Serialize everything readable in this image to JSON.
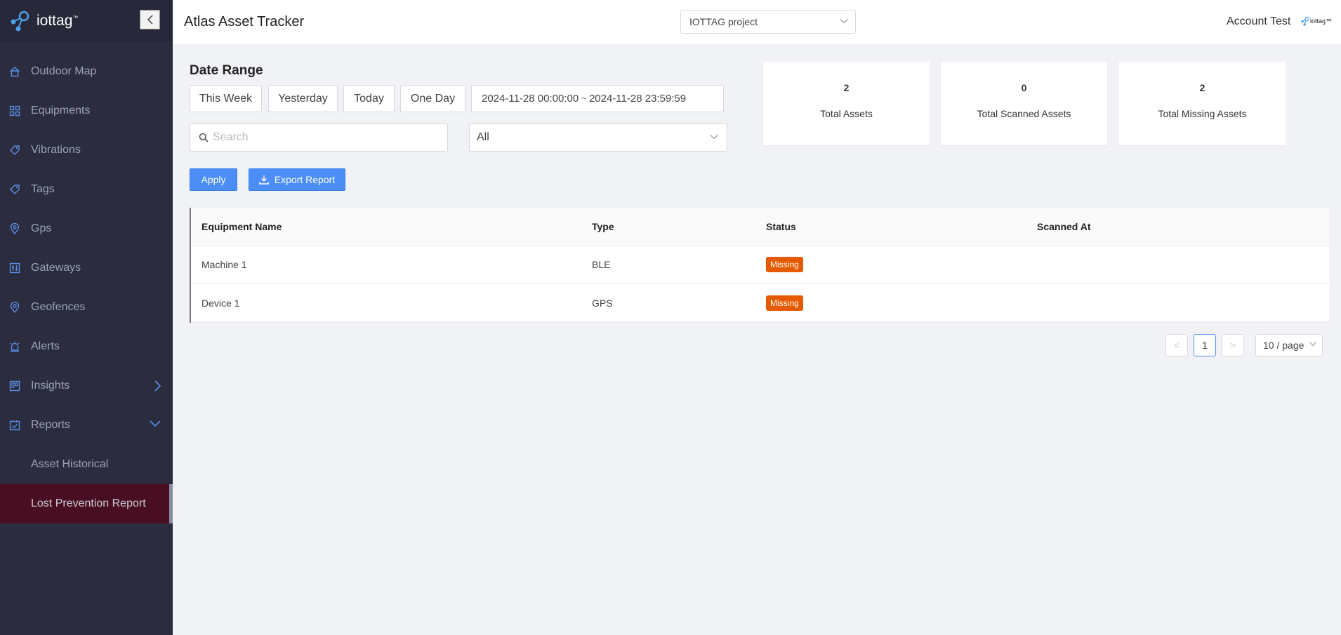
{
  "brand": {
    "name": "iottag",
    "tm": "™"
  },
  "header": {
    "title": "Atlas Asset Tracker",
    "project": "IOTTAG project",
    "account": "Account Test",
    "mini_logo": "iottag™"
  },
  "sidebar": {
    "items": [
      {
        "label": "Outdoor Map",
        "icon": "home-icon"
      },
      {
        "label": "Equipments",
        "icon": "grid-icon"
      },
      {
        "label": "Vibrations",
        "icon": "tag-icon"
      },
      {
        "label": "Tags",
        "icon": "tag-icon"
      },
      {
        "label": "Gps",
        "icon": "location-pin-icon"
      },
      {
        "label": "Gateways",
        "icon": "sliders-icon"
      },
      {
        "label": "Geofences",
        "icon": "location-pin-icon"
      },
      {
        "label": "Alerts",
        "icon": "alarm-icon"
      },
      {
        "label": "Insights",
        "icon": "board-icon"
      },
      {
        "label": "Reports",
        "icon": "checklist-icon"
      }
    ],
    "sub_items": [
      {
        "label": "Asset Historical"
      },
      {
        "label": "Lost Prevention Report"
      }
    ]
  },
  "filters": {
    "heading": "Date Range",
    "quick_ranges": [
      "This Week",
      "Yesterday",
      "Today",
      "One Day"
    ],
    "range_start": "2024-11-28 00:00:00",
    "range_sep": "~",
    "range_end": "2024-11-28 23:59:59",
    "search_placeholder": "Search",
    "type_filter": "All",
    "apply_label": "Apply",
    "export_label": "Export Report"
  },
  "stats": [
    {
      "value": "2",
      "label": "Total Assets"
    },
    {
      "value": "0",
      "label": "Total Scanned Assets"
    },
    {
      "value": "2",
      "label": "Total Missing Assets"
    }
  ],
  "table": {
    "columns": [
      "Equipment Name",
      "Type",
      "Status",
      "Scanned At"
    ],
    "rows": [
      {
        "name": "Machine 1",
        "type": "BLE",
        "status": "Missing",
        "scanned_at": ""
      },
      {
        "name": "Device 1",
        "type": "GPS",
        "status": "Missing",
        "scanned_at": ""
      }
    ]
  },
  "pagination": {
    "prev": "<",
    "current_page": "1",
    "next": ">",
    "page_size": "10 / page"
  },
  "colors": {
    "sidebar_bg": "#2b2d3e",
    "active_item_bg": "#4a0e23",
    "primary": "#4c8ef7",
    "missing_badge": "#e55a00"
  }
}
